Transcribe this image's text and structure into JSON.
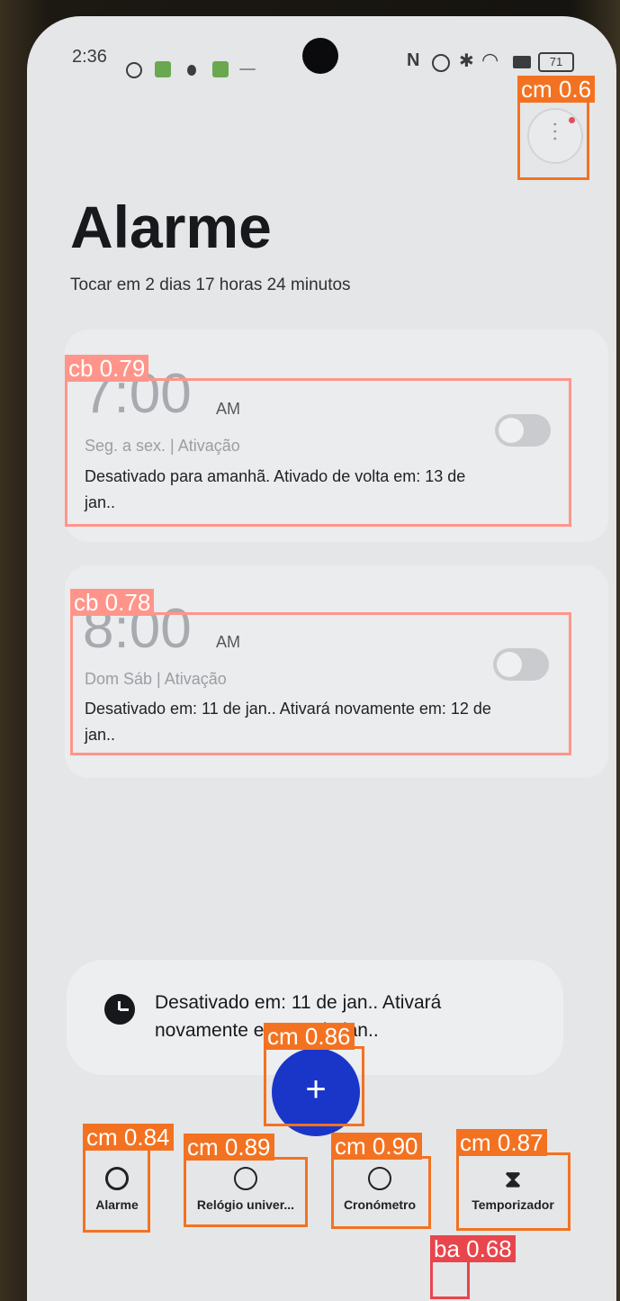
{
  "status_bar": {
    "time": "2:36",
    "battery": "71"
  },
  "header": {
    "title": "Alarme",
    "subtitle": "Tocar em 2 dias 17 horas 24 minutos"
  },
  "alarms": [
    {
      "time": "7:00",
      "ampm": "AM",
      "days": "Seg. a sex. | Ativação",
      "description": "Desativado para amanhã. Ativado de volta em: 13 de jan..",
      "enabled": false
    },
    {
      "time": "8:00",
      "ampm": "AM",
      "days": "Dom Sáb | Ativação",
      "description": "Desativado em: 11 de jan.. Ativará novamente em: 12 de jan..",
      "enabled": false
    }
  ],
  "toast": {
    "text": "Desativado em: 11 de jan.. Ativará novamente em: 12 de jan.."
  },
  "fab": {
    "label": "+"
  },
  "tabs": [
    {
      "label": "Alarme",
      "icon": "alarm-clock-icon"
    },
    {
      "label": "Relógio univer...",
      "icon": "globe-icon"
    },
    {
      "label": "Cronómetro",
      "icon": "stopwatch-icon"
    },
    {
      "label": "Temporizador",
      "icon": "hourglass-icon"
    }
  ],
  "detections": [
    {
      "label": "cm 0.6"
    },
    {
      "label": "cb 0.79"
    },
    {
      "label": "cb 0.78"
    },
    {
      "label": "cm 0.86"
    },
    {
      "label": "cm 0.84"
    },
    {
      "label": "cm 0.89"
    },
    {
      "label": "cm 0.90"
    },
    {
      "label": "cm 0.87"
    },
    {
      "label": "ba 0.68"
    }
  ],
  "colors": {
    "accent": "#1a36c8",
    "detection_cb": "#ff958a",
    "detection_cm": "#f37221",
    "detection_ba": "#e8454c"
  }
}
